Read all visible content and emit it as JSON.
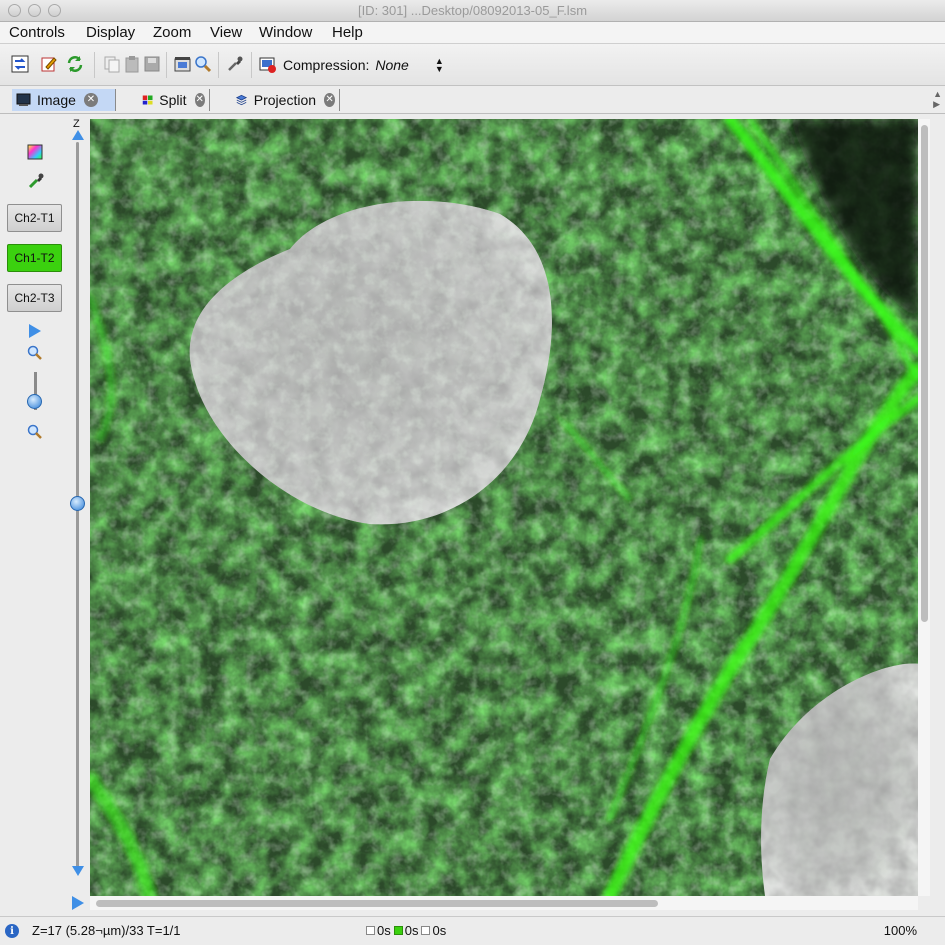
{
  "window": {
    "title": "[ID: 301] ...Desktop/08092013-05_F.lsm",
    "controls": [
      "close-button",
      "minimize-button",
      "zoom-button"
    ]
  },
  "menubar": {
    "items": [
      "Controls",
      "Display",
      "Zoom",
      "View",
      "Window",
      "Help"
    ]
  },
  "toolbar": {
    "icons": [
      "image-info-icon",
      "edit-icon",
      "refresh-icon",
      "copy-icon",
      "paste-icon",
      "save-icon",
      "movie-icon",
      "zoom-icon",
      "pipette-icon",
      "compression-icon"
    ],
    "compression_label": "Compression:",
    "compression_value": "None"
  },
  "tabs": [
    {
      "label": "Image",
      "active": true,
      "icon": "image-tab-icon"
    },
    {
      "label": "Split",
      "active": false,
      "icon": "split-tab-icon"
    },
    {
      "label": "Projection",
      "active": false,
      "icon": "projection-tab-icon"
    }
  ],
  "left_panel": {
    "icons": [
      "color-palette-icon",
      "pipette-icon",
      "play-icon",
      "zoom-in-icon",
      "zoom-out-icon"
    ],
    "channels": [
      {
        "label": "Ch2-T1",
        "color": "#d8d8d8"
      },
      {
        "label": "Ch1-T2",
        "color": "#3bd10f"
      },
      {
        "label": "Ch2-T3",
        "color": "#d8d8d8"
      }
    ],
    "z_label": "Z",
    "z_position": 0.5
  },
  "status": {
    "text": "Z=17 (5.28¬µm)/33 T=1/1",
    "timers": [
      "0s",
      "0s",
      "0s"
    ],
    "zoom": "100%"
  }
}
